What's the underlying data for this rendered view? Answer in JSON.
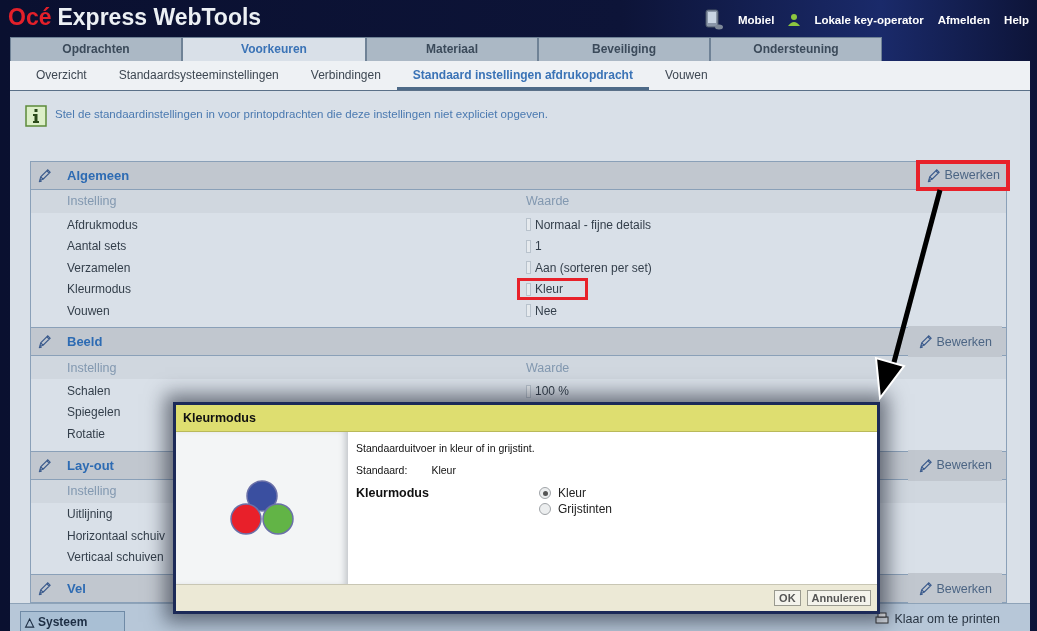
{
  "header": {
    "logo_brand": "Océ",
    "logo_product": "Express WebTools",
    "links": [
      {
        "kind": "mobile",
        "label": "Mobiel"
      },
      {
        "kind": "user",
        "label": "Lokale key-operator"
      },
      {
        "kind": "plain",
        "label": "Afmelden"
      },
      {
        "kind": "plain",
        "label": "Help"
      }
    ]
  },
  "tabs": [
    {
      "label": "Opdrachten",
      "selected": false
    },
    {
      "label": "Voorkeuren",
      "selected": true
    },
    {
      "label": "Materiaal",
      "selected": false
    },
    {
      "label": "Beveiliging",
      "selected": false
    },
    {
      "label": "Ondersteuning",
      "selected": false
    }
  ],
  "subtabs": [
    {
      "label": "Overzicht",
      "selected": false
    },
    {
      "label": "Standaardsysteeminstellingen",
      "selected": false
    },
    {
      "label": "Verbindingen",
      "selected": false
    },
    {
      "label": "Standaard instellingen afdrukopdracht",
      "selected": true
    },
    {
      "label": "Vouwen",
      "selected": false
    }
  ],
  "info": "Stel de standaardinstellingen in voor printopdrachten die deze instellingen niet expliciet opgeven.",
  "sections": [
    {
      "title": "Algemeen",
      "edit_label": "Bewerken",
      "edit_highlighted": true,
      "setting_header": "Instelling",
      "value_header": "Waarde",
      "rows": [
        {
          "setting": "Afdrukmodus",
          "value": "Normaal - fijne details",
          "highlighted": false
        },
        {
          "setting": "Aantal sets",
          "value": "1",
          "highlighted": false
        },
        {
          "setting": "Verzamelen",
          "value": "Aan (sorteren per set)",
          "highlighted": false
        },
        {
          "setting": "Kleurmodus",
          "value": "Kleur",
          "highlighted": true
        },
        {
          "setting": "Vouwen",
          "value": "Nee",
          "highlighted": false
        }
      ]
    },
    {
      "title": "Beeld",
      "edit_label": "Bewerken",
      "edit_highlighted": false,
      "setting_header": "Instelling",
      "value_header": "Waarde",
      "rows": [
        {
          "setting": "Schalen",
          "value": "100 %",
          "highlighted": false
        },
        {
          "setting": "Spiegelen"
        },
        {
          "setting": "Rotatie"
        }
      ]
    },
    {
      "title": "Lay-out",
      "edit_label": "Bewerken",
      "edit_highlighted": false,
      "setting_header": "Instelling",
      "rows": [
        {
          "setting": "Uitlijning"
        },
        {
          "setting": "Horizontaal schuiv"
        },
        {
          "setting": "Verticaal schuiven"
        }
      ]
    },
    {
      "title": "Vel",
      "edit_label": "Bewerken",
      "edit_highlighted": false
    }
  ],
  "dialog": {
    "title": "Kleurmodus",
    "description": "Standaarduitvoer in kleur of in grijstint.",
    "default_label": "Standaard:",
    "default_value": "Kleur",
    "field_label": "Kleurmodus",
    "options": [
      {
        "label": "Kleur",
        "selected": true
      },
      {
        "label": "Grijstinten",
        "selected": false
      }
    ],
    "buttons": [
      "OK",
      "Annuleren"
    ]
  },
  "status_bar": {
    "tab_icon": "△",
    "tab": "Systeem",
    "status": "Klaar om te printen"
  }
}
